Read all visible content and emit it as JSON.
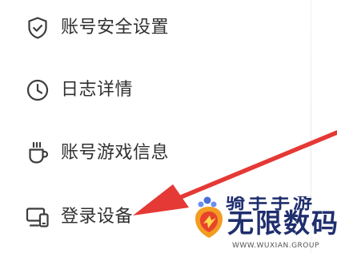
{
  "menu": {
    "items": [
      {
        "icon": "shield-check-icon",
        "label": "账号安全设置"
      },
      {
        "icon": "clock-icon",
        "label": "日志详情"
      },
      {
        "icon": "coffee-cup-icon",
        "label": "账号游戏信息"
      },
      {
        "icon": "login-devices-icon",
        "label": "登录设备"
      }
    ]
  },
  "annotation": {
    "icon": "red-arrow-icon",
    "color": "#e53935"
  },
  "watermark": {
    "top_text": "骑手手游",
    "main_text": "无限数码",
    "url": "WWW.WUXIAN.GROUP",
    "text_color": "#1f2e6d"
  },
  "colors": {
    "text": "#303030",
    "icon_stroke": "#3c3c3c",
    "arrow": "#e53935"
  }
}
